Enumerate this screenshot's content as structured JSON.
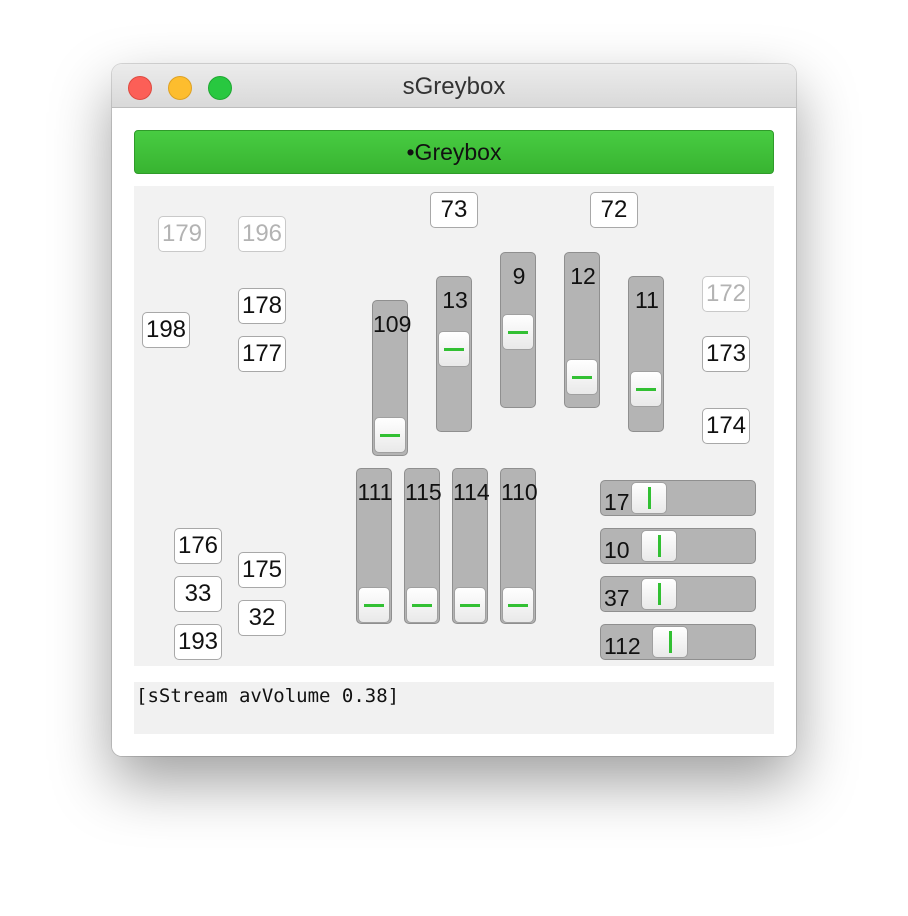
{
  "window": {
    "title": "sGreybox"
  },
  "greenbar": {
    "label": "•Greybox"
  },
  "number_boxes": [
    {
      "value": "179",
      "enabled": false
    },
    {
      "value": "196",
      "enabled": false
    },
    {
      "value": "198",
      "enabled": true
    },
    {
      "value": "178",
      "enabled": true
    },
    {
      "value": "177",
      "enabled": true
    },
    {
      "value": "73",
      "enabled": true
    },
    {
      "value": "72",
      "enabled": true
    },
    {
      "value": "172",
      "enabled": false
    },
    {
      "value": "173",
      "enabled": true
    },
    {
      "value": "174",
      "enabled": true
    },
    {
      "value": "176",
      "enabled": true
    },
    {
      "value": "33",
      "enabled": true
    },
    {
      "value": "193",
      "enabled": true
    },
    {
      "value": "175",
      "enabled": true
    },
    {
      "value": "32",
      "enabled": true
    }
  ],
  "vertical_sliders": [
    {
      "label": "109",
      "level": 0.02
    },
    {
      "label": "13",
      "level": 0.54
    },
    {
      "label": "9",
      "level": 0.48
    },
    {
      "label": "12",
      "level": 0.1
    },
    {
      "label": "11",
      "level": 0.2
    },
    {
      "label": "111",
      "level": 0.0
    },
    {
      "label": "115",
      "level": 0.0
    },
    {
      "label": "114",
      "level": 0.0
    },
    {
      "label": "110",
      "level": 0.0
    }
  ],
  "horizontal_sliders": [
    {
      "label": "17",
      "level": 0.25
    },
    {
      "label": "10",
      "level": 0.34
    },
    {
      "label": "37",
      "level": 0.34
    },
    {
      "label": "112",
      "level": 0.43
    }
  ],
  "post_window": {
    "text": "[sStream avVolume 0.38]"
  },
  "colors": {
    "accent_green": "#32c033",
    "greenbar": "#40c03a",
    "slider_track": "#b4b4b4"
  }
}
